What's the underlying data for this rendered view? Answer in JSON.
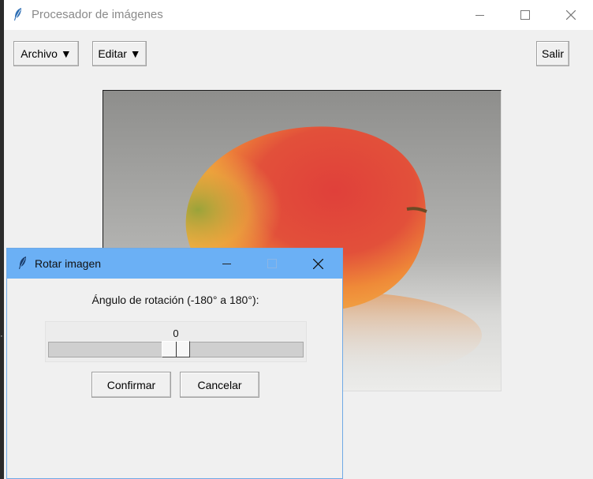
{
  "main_window": {
    "title": "Procesador de imágenes",
    "menu": {
      "archivo": "Archivo ▼",
      "editar": "Editar ▼"
    },
    "exit_button": "Salir",
    "image": {
      "subject": "mango"
    }
  },
  "dialog": {
    "title": "Rotar imagen",
    "angle_label": "Ángulo de rotación (-180° a 180°):",
    "slider": {
      "value": "0",
      "min": -180,
      "max": 180,
      "current": 0
    },
    "confirm_button": "Confirmar",
    "cancel_button": "Cancelar"
  },
  "icons": {
    "app": "feather-icon",
    "minimize": "minimize-icon",
    "maximize": "maximize-icon",
    "close": "close-icon"
  },
  "colors": {
    "dialog_titlebar": "#6bb0f5",
    "window_bg": "#f0f0f0"
  }
}
